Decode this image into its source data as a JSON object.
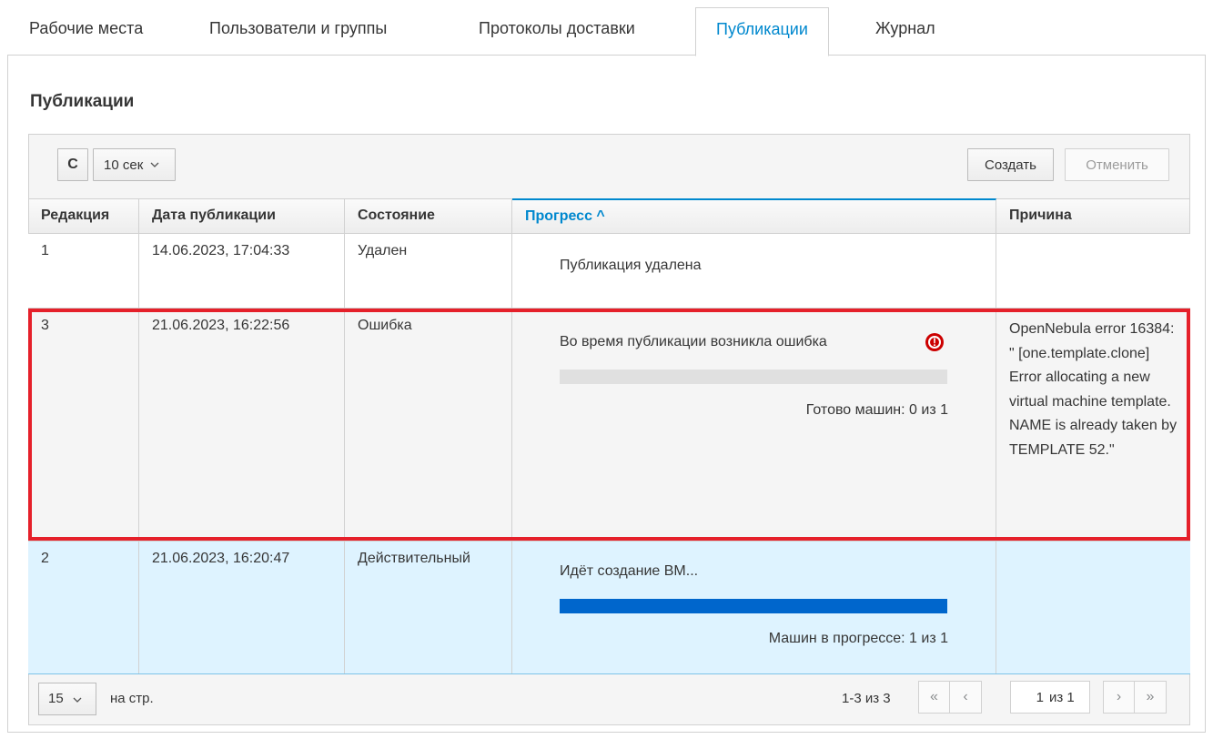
{
  "tabs": [
    {
      "label": "Рабочие места",
      "active": false
    },
    {
      "label": "Пользователи и группы",
      "active": false
    },
    {
      "label": "Протоколы доставки",
      "active": false
    },
    {
      "label": "Публикации",
      "active": true
    },
    {
      "label": "Журнал",
      "active": false
    }
  ],
  "section_title": "Публикации",
  "toolbar": {
    "refresh_icon": "refresh-icon",
    "refresh_glyph": "C",
    "interval": "10 сек",
    "create_label": "Создать",
    "cancel_label": "Отменить"
  },
  "columns": [
    {
      "label": "Редакция"
    },
    {
      "label": "Дата публикации"
    },
    {
      "label": "Состояние"
    },
    {
      "label": "Прогресс ^",
      "sorted": true
    },
    {
      "label": "Причина"
    }
  ],
  "rows": [
    {
      "revision": "1",
      "date": "14.06.2023, 17:04:33",
      "state": "Удален",
      "progress_message": "Публикация удалена",
      "progress_count": "",
      "reason": ""
    },
    {
      "revision": "3",
      "date": "21.06.2023, 16:22:56",
      "state": "Ошибка",
      "progress_message": "Во время публикации возникла ошибка",
      "progress_fraction": 0,
      "progress_count": "Готово машин: 0 из 1",
      "error_icon_glyph": "!",
      "reason": "OpenNebula error 16384: \" [one.template.clone] Error allocating a new virtual machine template. NAME is already taken by TEMPLATE 52.\""
    },
    {
      "revision": "2",
      "date": "21.06.2023, 16:20:47",
      "state": "Действительный",
      "progress_message": "Идёт создание ВМ...",
      "progress_fraction": 1,
      "progress_count": "Машин в прогрессе: 1 из 1",
      "reason": ""
    }
  ],
  "footer": {
    "per_page_value": "15",
    "per_page_label": "на стр.",
    "range": "1-3 из 3",
    "first_glyph": "«",
    "prev_glyph": "‹",
    "next_glyph": "›",
    "last_glyph": "»",
    "page": "1",
    "of_pages": "из 1"
  },
  "colors": {
    "accent": "#0088ce",
    "error": "#cc0000",
    "highlight_border": "#e5202a",
    "selected_row": "#def3ff",
    "progress_fill": "#0066cc"
  }
}
